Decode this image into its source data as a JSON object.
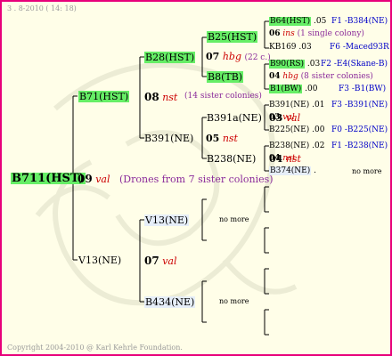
{
  "header": {
    "date": "3 . 8-2010 ( 14: 18)"
  },
  "footer": {
    "copyright": "Copyright 2004-2010 @ Karl Kehrle Foundation."
  },
  "root": {
    "id": "B711(HST)",
    "year": "09",
    "mark": "val",
    "note": "(Drones from 7 sister colonies)"
  },
  "gen1": {
    "father": {
      "id": "B71(HST)",
      "year": "08",
      "mark": "nst",
      "note": "(14 sister colonies)"
    },
    "mother": {
      "id": "V13(NE)",
      "year": "07",
      "mark": "val"
    }
  },
  "gen2": {
    "ff": {
      "id": "B28(HST)",
      "year": "07",
      "mark": "hbg",
      "note": "(22 c.)"
    },
    "fm": {
      "id": "B391(NE)",
      "year": "05",
      "mark": "nst"
    },
    "mf": {
      "id": "V13(NE)",
      "no_more": "no more"
    },
    "mm": {
      "id": "B434(NE)",
      "no_more": "no more"
    }
  },
  "gen3": {
    "fff": {
      "id": "B25(HST)"
    },
    "ffm": {
      "id": "B8(TB)"
    },
    "fmf": {
      "id": "B391a(NE)",
      "year": "03",
      "mark": "val"
    },
    "fmm": {
      "id": "B238(NE)",
      "year": "04",
      "mark": "nst"
    }
  },
  "gen4": {
    "r1": {
      "id": "B64(HST)",
      "num": ".05",
      "ref": "F1 -B384(NE)"
    },
    "r2": {
      "year": "06",
      "mark": "ins",
      "note": "(1 single colony)"
    },
    "r3": {
      "id": "KB169",
      "num": ".03",
      "ref": "F6 -Maced93R"
    },
    "r4": {
      "id": "B90(RS)",
      "num": ".03",
      "ref": "F2 -E4(Skane-B)"
    },
    "r5": {
      "year": "04",
      "mark": "hbg",
      "note": "(8 sister colonies)"
    },
    "r6": {
      "id": "B1(BW)",
      "num": ".00",
      "ref": "F3 -B1(BW)"
    },
    "r7": {
      "id": "B391(NE)",
      "num": ".01",
      "ref": "F3 -B391(NE)"
    },
    "r8": {
      "year": "03",
      "mark": "val"
    },
    "r9": {
      "id": "B225(NE)",
      "num": ".00",
      "ref": "F0 -B225(NE)"
    },
    "r10": {
      "id": "B238(NE)",
      "num": ".02",
      "ref": "F1 -B238(NE)"
    },
    "r11": {
      "year": "04",
      "mark": "nst"
    },
    "r12": {
      "id": "B374(NE)",
      "num": ".",
      "no_more": "no more"
    }
  },
  "colors": {
    "border": "#e8007a",
    "background": "#fffee8",
    "highlight": "#66ee66",
    "light_blue": "#e6eef8",
    "ref_text": "#0000c8",
    "note_text": "#8a2a9a",
    "mark_text": "#cc0000"
  }
}
